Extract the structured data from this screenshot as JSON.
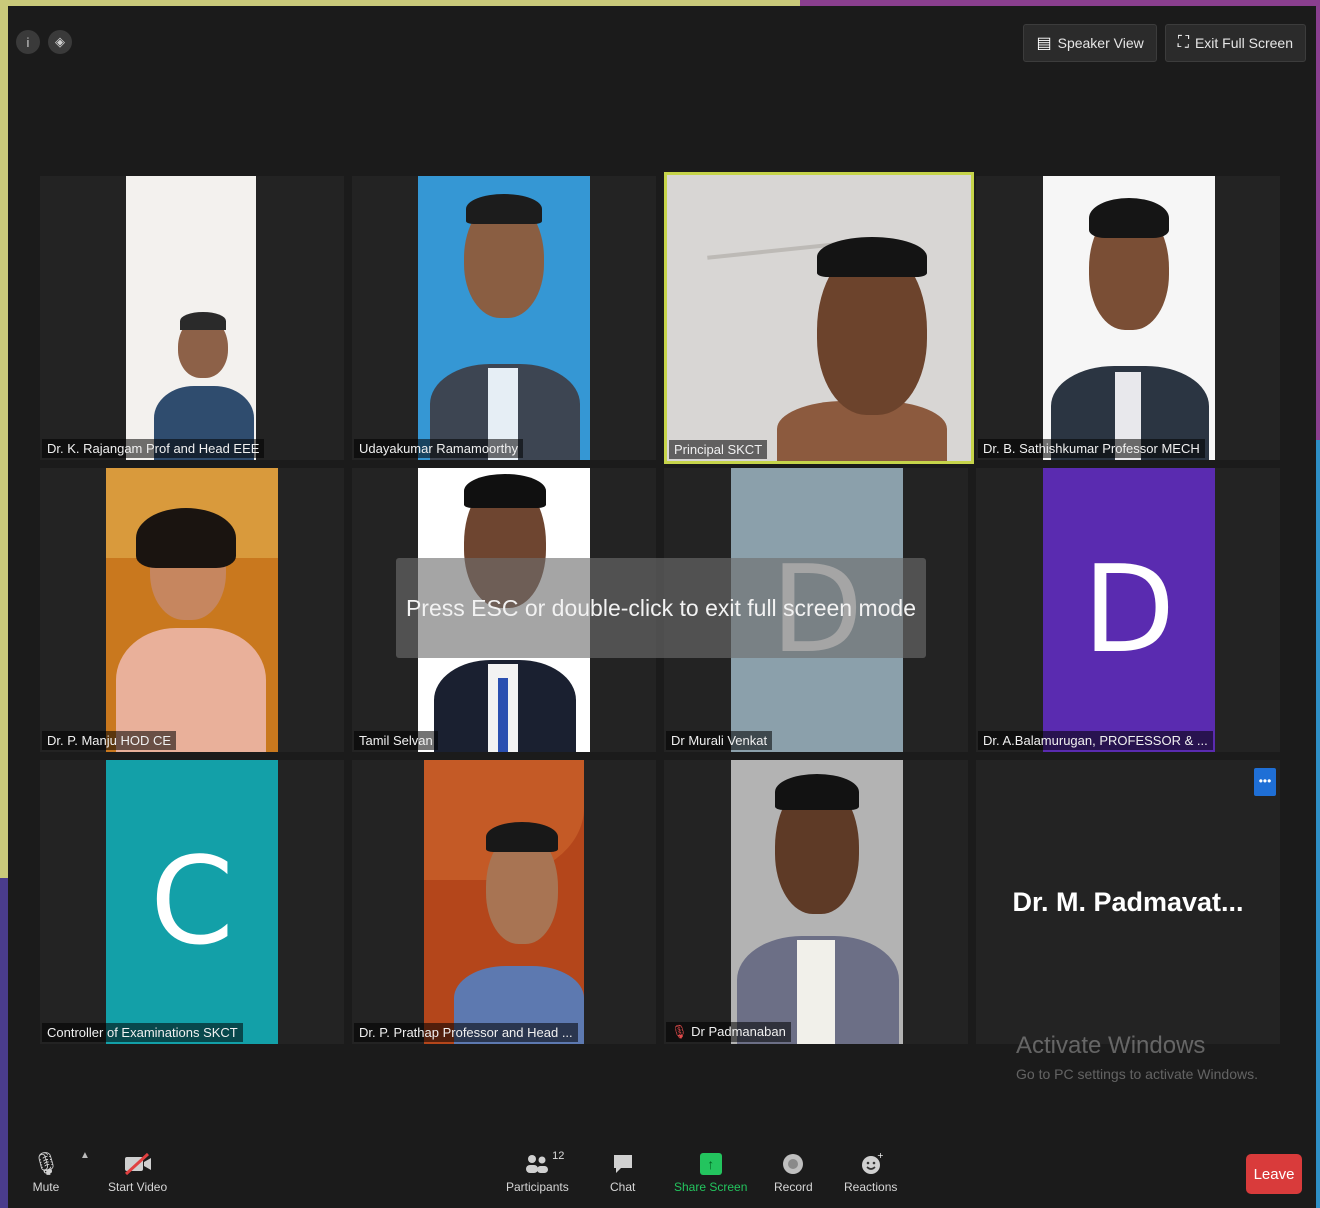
{
  "top_bar": {
    "speaker_view_label": "Speaker View",
    "exit_full_screen_label": "Exit Full Screen"
  },
  "participants": [
    {
      "name": "Dr. K. Rajangam Prof and Head EEE"
    },
    {
      "name": "Udayakumar Ramamoorthy"
    },
    {
      "name": "Principal SKCT"
    },
    {
      "name": "Dr. B. Sathishkumar Professor MECH"
    },
    {
      "name": "Dr. P. Manju HOD CE"
    },
    {
      "name": "Tamil Selvan"
    },
    {
      "name": "Dr Murali Venkat",
      "avatar_letter": "D"
    },
    {
      "name": "Dr. A.Balamurugan, PROFESSOR & ...",
      "avatar_letter": "D"
    },
    {
      "name": "Controller of Examinations SKCT",
      "avatar_letter": "C"
    },
    {
      "name": "Dr. P. Prathap Professor and Head ..."
    },
    {
      "name": "Dr Padmanaban"
    },
    {
      "name": "Dr. M. Padmavat..."
    }
  ],
  "overlay_message": "Press ESC or double-click to exit full screen mode",
  "watermark": {
    "title": "Activate Windows",
    "subtitle": "Go to PC settings to activate Windows."
  },
  "toolbar": {
    "mute_label": "Mute",
    "start_video_label": "Start Video",
    "participants_label": "Participants",
    "participants_count": "12",
    "chat_label": "Chat",
    "share_screen_label": "Share Screen",
    "record_label": "Record",
    "reactions_label": "Reactions",
    "leave_label": "Leave"
  },
  "colors": {
    "active_speaker_border": "#c6d44a",
    "share_green": "#23c45e",
    "leave_red": "#d93b3b",
    "avatar_purple": "#5a2bb0",
    "avatar_teal": "#13a0a8",
    "avatar_grey": "#8ba0ab"
  }
}
